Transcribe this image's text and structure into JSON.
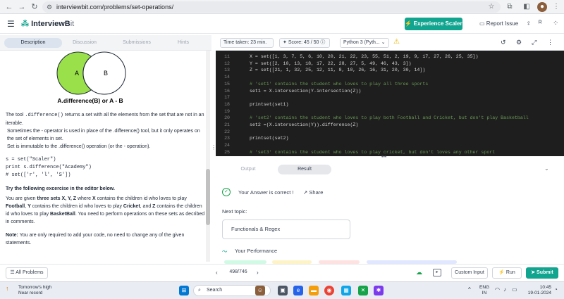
{
  "browser": {
    "url": "interviewbit.com/problems/set-operations/"
  },
  "header": {
    "logo_main": "InterviewB",
    "logo_tail": "it",
    "cta": "Experience Scaler",
    "report": "Report Issue"
  },
  "left_tabs": [
    "Description",
    "Discussion",
    "Submissions",
    "Hints"
  ],
  "venn": {
    "a": "A",
    "b": "B",
    "caption": "A.difference(B) or A - B",
    "accent": "#9ae04a"
  },
  "description": {
    "p1_pre": "The tool ",
    "p1_code": ".difference()",
    "p1_post": " returns a set with all the elements from the set that are not in an iterable.",
    "p2": "Sometimes the - operator is used in place of the .difference() tool, but it only operates on the set of elements in set.",
    "p3": "Set is immutable to the .difference() operation (or the - operation).",
    "code1": "s = set(\"Scaler\")",
    "code2": "print s.difference(\"Academy\")",
    "code3": "# set(['r', 'l', 'S'])",
    "heading": "Try the following excercise in the editor below.",
    "p4_1": "You are given ",
    "p4_2": "three sets X, Y, Z",
    "p4_3": " where ",
    "p4_4": "X",
    "p4_5": " contains the children id who loves to play ",
    "p4_6": "Football",
    "p4_7": ", ",
    "p4_8": "Y",
    "p4_9": " contains the children id who loves to play ",
    "p4_10": "Cricket",
    "p4_11": ", and ",
    "p4_12": "Z",
    "p4_13": " contains the children id who loves to play ",
    "p4_14": "BasketBall",
    "p4_15": ". You need to perform operations on these sets as decribed in comments.",
    "note_label": "Note:",
    "note": " You are only required to add your code, no need to change any of the given statements."
  },
  "toolbar": {
    "time": "Time taken: 23 min.",
    "score": "Score: 45 / 50",
    "lang": "Python 3 (Pyth..."
  },
  "code_lines": [
    {
      "n": "11",
      "t": "X = set([1, 3, 7, 5, 6, 10, 20, 21, 22, 23, 55, 51, 2, 19, 9, 17, 27, 26, 25, 35])",
      "c": false
    },
    {
      "n": "12",
      "t": "Y = set([2, 10, 13, 18, 17, 22, 28, 27, 5, 49, 46, 43, 3])",
      "c": false
    },
    {
      "n": "13",
      "t": "Z = set([21, 1, 32, 25, 12, 11, 8, 10, 26, 16, 31, 20, 30, 14])",
      "c": false
    },
    {
      "n": "14",
      "t": "",
      "c": false
    },
    {
      "n": "15",
      "t": "# 'set1' contains the student who loves to play all three sports",
      "c": true
    },
    {
      "n": "16",
      "t": "set1 = X.intersection(Y.intersection(Z))",
      "c": false
    },
    {
      "n": "17",
      "t": "",
      "c": false
    },
    {
      "n": "18",
      "t": "printset(set1)",
      "c": false
    },
    {
      "n": "19",
      "t": "",
      "c": false
    },
    {
      "n": "20",
      "t": "# 'set2' contains the student who loves to play both Football and Cricket, but don't play Basketball",
      "c": true
    },
    {
      "n": "21",
      "t": "set2 =(X.intersection(Y)).difference(Z)",
      "c": false
    },
    {
      "n": "22",
      "t": "",
      "c": false
    },
    {
      "n": "23",
      "t": "printset(set2)",
      "c": false
    },
    {
      "n": "24",
      "t": "",
      "c": false
    },
    {
      "n": "25",
      "t": "# 'set3' contains the student who loves to play cricket, but don't loves any other sport",
      "c": true
    }
  ],
  "output_tabs": [
    "Output",
    "Result"
  ],
  "result": {
    "status": "Your Answer is correct !",
    "share": "Share",
    "next_topic_label": "Next topic:",
    "next_topic": "Functionals & Regex",
    "performance": "Your Performance"
  },
  "bottom": {
    "all_problems": "All Problems",
    "page": "498/746",
    "custom_input": "Custom Input",
    "run": "Run",
    "submit": "Submit"
  },
  "taskbar": {
    "weather_1": "Tomorrow's high",
    "weather_2": "Near record",
    "search": "Search",
    "lang": "ENG",
    "lang2": "IN",
    "time": "10:45",
    "date": "19-01-2024"
  }
}
